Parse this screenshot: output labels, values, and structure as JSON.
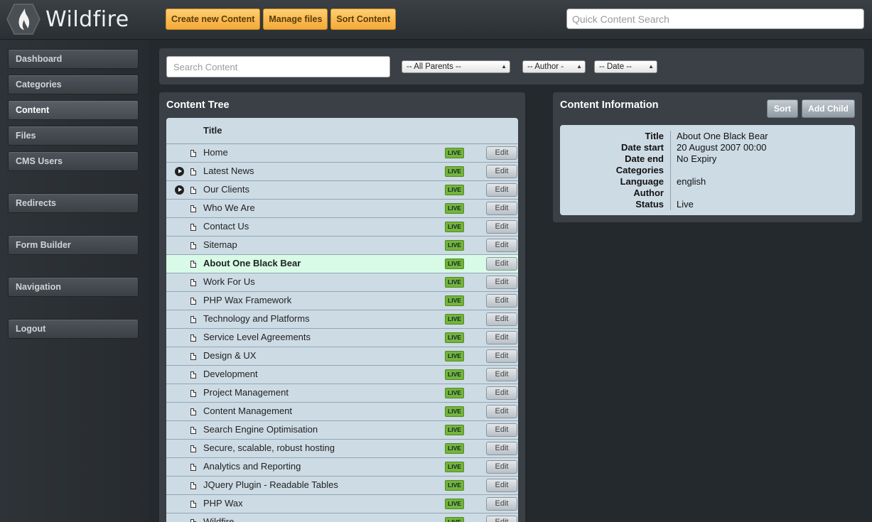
{
  "header": {
    "logo_text": "Wildfire",
    "buttons": [
      "Create new Content",
      "Manage files",
      "Sort Content"
    ],
    "quick_search_placeholder": "Quick Content Search"
  },
  "sidebar": {
    "items": [
      "Dashboard",
      "Categories",
      "Content",
      "Files",
      "CMS Users",
      "Redirects",
      "Form Builder",
      "Navigation",
      "Logout"
    ],
    "active": "Content"
  },
  "filters": {
    "search_placeholder": "Search Content",
    "parent": "-- All Parents --",
    "author": "-- Author -",
    "date": "-- Date --"
  },
  "content_tree": {
    "title": "Content Tree",
    "column_title": "Title",
    "status_label": "LIVE",
    "edit_label": "Edit",
    "rows": [
      {
        "title": "Home",
        "expandable": false,
        "selected": false
      },
      {
        "title": "Latest News",
        "expandable": true,
        "selected": false
      },
      {
        "title": "Our Clients",
        "expandable": true,
        "selected": false
      },
      {
        "title": "Who We Are",
        "expandable": false,
        "selected": false
      },
      {
        "title": "Contact Us",
        "expandable": false,
        "selected": false
      },
      {
        "title": "Sitemap",
        "expandable": false,
        "selected": false
      },
      {
        "title": "About One Black Bear",
        "expandable": false,
        "selected": true
      },
      {
        "title": "Work For Us",
        "expandable": false,
        "selected": false
      },
      {
        "title": "PHP Wax Framework",
        "expandable": false,
        "selected": false
      },
      {
        "title": "Technology and Platforms",
        "expandable": false,
        "selected": false
      },
      {
        "title": "Service Level Agreements",
        "expandable": false,
        "selected": false
      },
      {
        "title": "Design & UX",
        "expandable": false,
        "selected": false
      },
      {
        "title": "Development",
        "expandable": false,
        "selected": false
      },
      {
        "title": "Project Management",
        "expandable": false,
        "selected": false
      },
      {
        "title": "Content Management",
        "expandable": false,
        "selected": false
      },
      {
        "title": "Search Engine Optimisation",
        "expandable": false,
        "selected": false
      },
      {
        "title": "Secure, scalable, robust hosting",
        "expandable": false,
        "selected": false
      },
      {
        "title": "Analytics and Reporting",
        "expandable": false,
        "selected": false
      },
      {
        "title": "JQuery Plugin - Readable Tables",
        "expandable": false,
        "selected": false
      },
      {
        "title": "PHP Wax",
        "expandable": false,
        "selected": false
      },
      {
        "title": "Wildfire",
        "expandable": false,
        "selected": false
      }
    ]
  },
  "content_info": {
    "title": "Content Information",
    "sort_label": "Sort",
    "add_child_label": "Add Child",
    "fields": [
      {
        "label": "Title",
        "value": "About One Black Bear"
      },
      {
        "label": "Date start",
        "value": "20 August 2007 00:00"
      },
      {
        "label": "Date end",
        "value": "No Expiry"
      },
      {
        "label": "Categories",
        "value": ""
      },
      {
        "label": "Language",
        "value": "english"
      },
      {
        "label": "Author",
        "value": ""
      },
      {
        "label": "Status",
        "value": "Live"
      }
    ]
  },
  "colors": {
    "accent_orange": "#f4a938",
    "live_green": "#74b53a",
    "panel_bg": "#3a4045",
    "table_bg": "#cddbe5",
    "selected_row": "#d7fbe6"
  }
}
